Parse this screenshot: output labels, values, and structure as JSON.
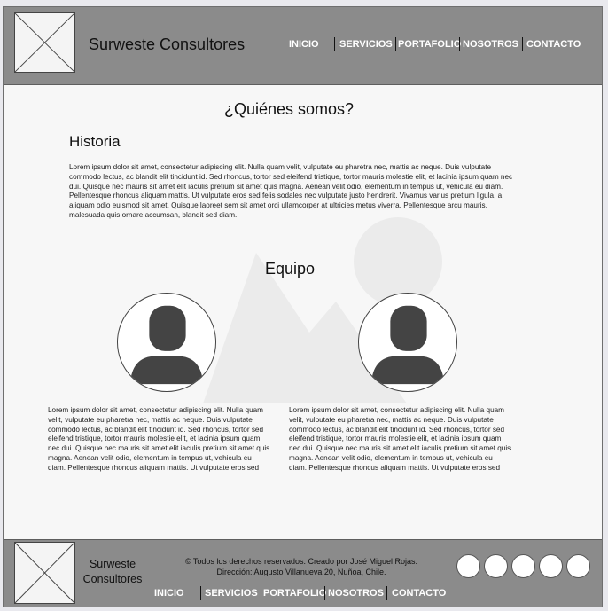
{
  "header": {
    "brand": "Surweste Consultores",
    "nav": [
      "INICIO",
      "SERVICIOS",
      "PORTAFOLIO",
      "NOSOTROS",
      "CONTACTO"
    ]
  },
  "about": {
    "title": "¿Quiénes somos?",
    "history_heading": "Historia",
    "history_text": "Lorem ipsum dolor sit amet, consectetur adipiscing elit. Nulla quam velit, vulputate eu pharetra nec, mattis ac neque. Duis vulputate commodo lectus, ac blandit elit tincidunt id. Sed rhoncus, tortor sed eleifend tristique, tortor mauris molestie elit, et lacinia ipsum quam nec dui. Quisque nec mauris sit amet elit iaculis pretium sit amet quis magna. Aenean velit odio, elementum in tempus ut, vehicula eu diam. Pellentesque rhoncus aliquam mattis. Ut vulputate eros sed felis sodales nec vulputate justo hendrerit. Vivamus varius pretium ligula, a aliquam odio euismod sit amet. Quisque laoreet sem sit amet orci ullamcorper at ultricies metus viverra. Pellentesque arcu mauris, malesuada quis ornare accumsan, blandit sed diam.",
    "team_heading": "Equipo",
    "members": [
      {
        "text": "Lorem ipsum dolor sit amet, consectetur adipiscing elit. Nulla quam velit, vulputate eu pharetra nec, mattis ac neque. Duis vulputate commodo lectus, ac blandit elit tincidunt id. Sed rhoncus, tortor sed eleifend tristique, tortor mauris molestie elit, et lacinia ipsum quam nec dui. Quisque nec mauris sit amet elit iaculis pretium sit amet quis magna. Aenean velit odio, elementum in tempus ut, vehicula eu diam. Pellentesque rhoncus aliquam mattis. Ut vulputate eros sed"
      },
      {
        "text": "Lorem ipsum dolor sit amet, consectetur adipiscing elit. Nulla quam velit, vulputate eu pharetra nec, mattis ac neque. Duis vulputate commodo lectus, ac blandit elit tincidunt id. Sed rhoncus, tortor sed eleifend tristique, tortor mauris molestie elit, et lacinia ipsum quam nec dui. Quisque nec mauris sit amet elit iaculis pretium sit amet quis magna. Aenean velit odio, elementum in tempus ut, vehicula eu diam. Pellentesque rhoncus aliquam mattis. Ut vulputate eros sed"
      }
    ]
  },
  "footer": {
    "brand": "Surweste Consultores",
    "copyright": "© Todos los derechos reservados. Creado por José Miguel Rojas.",
    "address": "Dirección: Augusto Villanueva 20, Ñuñoa, Chile.",
    "nav": [
      "INICIO",
      "SERVICIOS",
      "PORTAFOLIO",
      "NOSOTROS",
      "CONTACTO"
    ],
    "social_icons": [
      "social-circle-1",
      "social-circle-2",
      "social-circle-3",
      "social-circle-4",
      "social-circle-5"
    ]
  },
  "colors": {
    "bar": "#8b8b8b",
    "page": "#f7f7f7",
    "nav_text": "#ffffff"
  }
}
